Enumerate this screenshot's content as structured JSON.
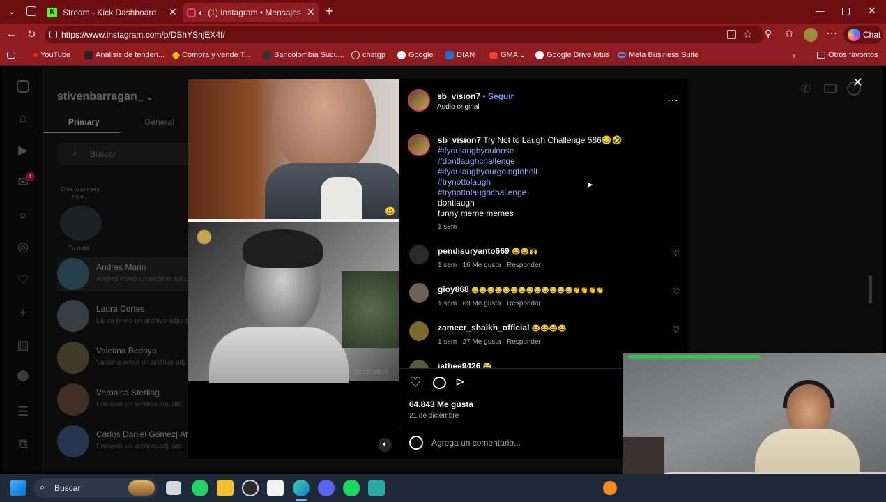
{
  "browser": {
    "tabs": [
      {
        "title": "Stream - Kick Dashboard",
        "active": false
      },
      {
        "title": "(1) Instagram • Mensajes",
        "active": true
      }
    ],
    "url": "https://www.instagram.com/p/DShYShjEX4f/",
    "chat_label": "Chat",
    "bookmarks": [
      "YouTube",
      "Análisis de tenden...",
      "Compra y vende T...",
      "Bancolombia Sucu...",
      "chatgp",
      "Google",
      "DIAN",
      "GMAIL",
      "Google Drive lotus",
      "Meta Business Suite"
    ],
    "other_favorites": "Otros favoritos"
  },
  "dm": {
    "username": "stivenbarragan_",
    "tabs": [
      "Primary",
      "General"
    ],
    "search_placeholder": "Buscar",
    "note_prompt": "Crea tu primera nota...",
    "note_label": "Tu nota",
    "side_badge": "1",
    "conversations": [
      {
        "name": "Andres Marin",
        "sub": "Andres envió un archivo adju..."
      },
      {
        "name": "Laura Cortes",
        "sub": "Laura envió un archivo adjunt..."
      },
      {
        "name": "Valetina Bedoya",
        "sub": "Valetina envió un archivo adj..."
      },
      {
        "name": "Veronica Sterling",
        "sub": "Enviaste un archivo adjunto."
      },
      {
        "name": "Carlos Daniel Gómez| Atle...",
        "sub": "Enviaste un archivo adjunto."
      }
    ]
  },
  "post": {
    "author": "sb_vision7",
    "follow": "Seguir",
    "audio": "Audio original",
    "caption_title": "Try Not to Laugh Challenge 586😂🤣",
    "hashtags": [
      "#ifyoulaughyouloose",
      "#dontlaughchallenge",
      "#ifyoulaughyourgoingtohell",
      "#trynottolaugh",
      "#trynottolaughchallenge"
    ],
    "caption_lines": [
      "dontlaugh",
      "funny meme memes"
    ],
    "caption_time": "1 sem",
    "comments": [
      {
        "user": "pendisuryanto669",
        "text": "😂😂🙌",
        "time": "1 sem",
        "likes": "16 Me gusta",
        "reply": "Responder"
      },
      {
        "user": "gioy868",
        "text": "😂😂😂😂😂😂😂😂😂😂😂😂😂👏👏👏👏",
        "time": "1 sem",
        "likes": "69 Me gusta",
        "reply": "Responder"
      },
      {
        "user": "zameer_shaikh_official",
        "text": "😂😂😂😂",
        "time": "1 sem",
        "likes": "27 Me gusta",
        "reply": "Responder"
      },
      {
        "user": "iathee9426",
        "text": "😂",
        "time": "",
        "likes": "",
        "reply": ""
      }
    ],
    "likes": "64.843 Me gusta",
    "date": "21 de diciembre",
    "comment_placeholder": "Agrega un comentario...",
    "video_watermark": "RNGM ARSIV"
  },
  "taskbar": {
    "search_label": "Buscar"
  },
  "colors": {
    "chrome_dark": "#6d0f12",
    "chrome": "#8e1c20",
    "link_blue": "#8fa8ff",
    "taskbar": "#1e2a3a"
  }
}
